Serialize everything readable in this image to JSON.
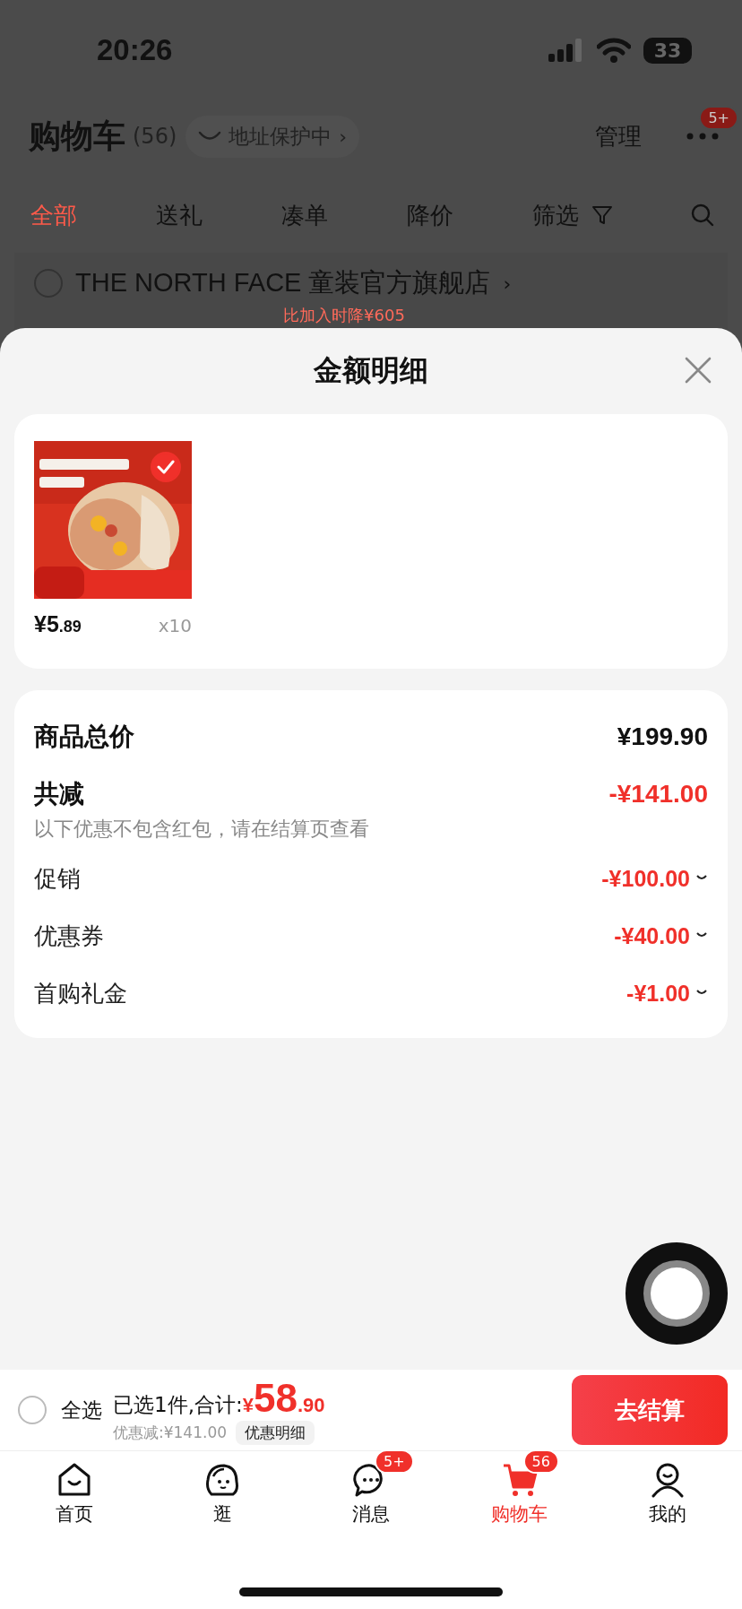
{
  "status_bar": {
    "time": "20:26",
    "battery": "33"
  },
  "header": {
    "title": "购物车",
    "count": "(56)",
    "address_chip": "地址保护中",
    "address_chevron": "›",
    "manage": "管理",
    "more_badge": "5+"
  },
  "tabs": [
    {
      "label": "全部",
      "selected": true
    },
    {
      "label": "送礼",
      "selected": false
    },
    {
      "label": "凑单",
      "selected": false
    },
    {
      "label": "降价",
      "selected": false
    },
    {
      "label": "筛选",
      "selected": false
    }
  ],
  "store": {
    "name": "THE NORTH FACE 童装官方旗舰店",
    "chevron": "›",
    "checked": false,
    "price_drop": "比加入时降¥605"
  },
  "sheet": {
    "title": "金额明细"
  },
  "items": [
    {
      "kind": "picture",
      "selected": true,
      "price_main": "¥5",
      "price_decimal": ".89",
      "quantity": "x10"
    }
  ],
  "summary": {
    "total_label": "商品总价",
    "total": "¥199.90",
    "reduction_label": "共减",
    "reduction": "-¥141.00",
    "note": "以下优惠不包含红包，请在结算页查看",
    "discounts": [
      {
        "label": "促销",
        "amount": "-¥100.00",
        "expanded": false
      },
      {
        "label": "优惠券",
        "amount": "-¥40.00",
        "expanded": false
      },
      {
        "label": "首购礼金",
        "amount": "-¥1.00",
        "expanded": false
      }
    ]
  },
  "checkout_bar": {
    "select_all_label": "全选",
    "select_all_checked": false,
    "selected_text": "已选1件,合计:",
    "currency": "¥",
    "amount_main": "58",
    "amount_decimal": ".90",
    "saved": "优惠减:¥141.00",
    "details_button": "优惠明细",
    "checkout_button": "去结算"
  },
  "tab_bar": [
    {
      "label": "首页",
      "kind": "home",
      "selected": false
    },
    {
      "label": "逛",
      "kind": "face",
      "selected": false
    },
    {
      "label": "消息",
      "kind": "chat",
      "badge": "5+",
      "selected": false
    },
    {
      "label": "购物车",
      "kind": "cart",
      "badge": "56",
      "selected": true
    },
    {
      "label": "我的",
      "kind": "person",
      "selected": false
    }
  ]
}
